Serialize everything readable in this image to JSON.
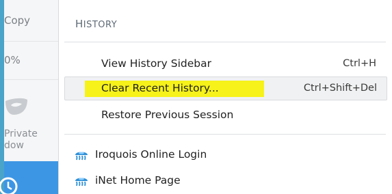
{
  "left_panel": {
    "copy_label": "Copy",
    "zoom_value": "0%",
    "private_label_line1": "Private",
    "private_label_line2": "dow"
  },
  "history_menu": {
    "header": "History",
    "header_first": "H",
    "header_rest": "ISTORY",
    "items": [
      {
        "label": "View History Sidebar",
        "shortcut": "Ctrl+H"
      },
      {
        "label": "Clear Recent History...",
        "shortcut": "Ctrl+Shift+Del"
      },
      {
        "label": "Restore Previous Session",
        "shortcut": ""
      }
    ],
    "bookmarks": [
      {
        "label": "Iroquois Online Login",
        "icon": "jellyfish-site-icon"
      },
      {
        "label": "iNet Home Page",
        "icon": "jellyfish-site-icon"
      }
    ]
  },
  "colors": {
    "highlight": "#f6f21a",
    "accent_blue": "#3d96e4",
    "site_icon_blue": "#2f8fd6"
  }
}
